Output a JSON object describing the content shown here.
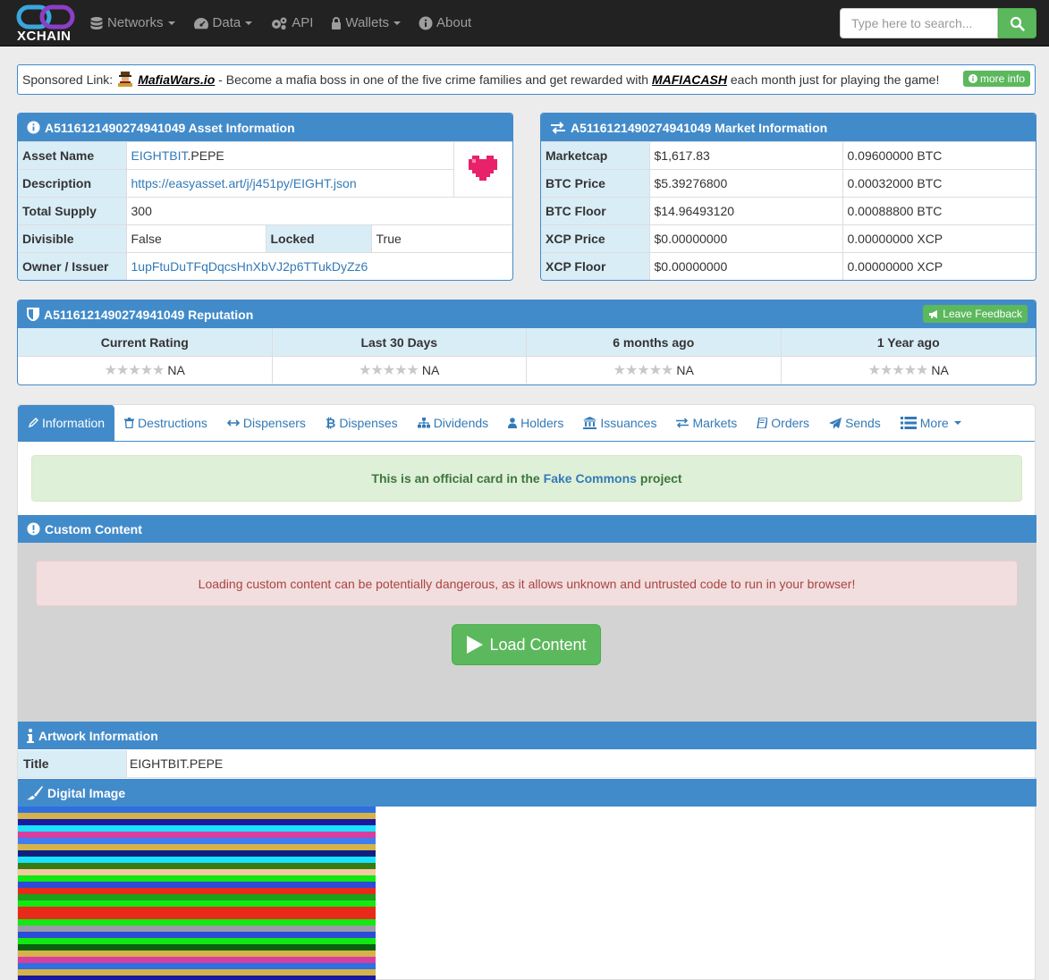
{
  "nav": {
    "brand": "XCHAIN",
    "items": [
      {
        "label": "Networks",
        "icon": "database-icon",
        "caret": true
      },
      {
        "label": "Data",
        "icon": "dashboard-icon",
        "caret": true
      },
      {
        "label": "API",
        "icon": "cogs-icon",
        "caret": false
      },
      {
        "label": "Wallets",
        "icon": "lock-icon",
        "caret": true
      },
      {
        "label": "About",
        "icon": "info-icon",
        "caret": false
      }
    ],
    "search_placeholder": "Type here to search..."
  },
  "sponsor": {
    "prefix": "Sponsored Link:",
    "link": "MafiaWars.io",
    "text1": " - Become a mafia boss in one of the five crime families and get rewarded with ",
    "token": "MAFIACASH",
    "text2": " each month just for playing the game!",
    "more": "more info"
  },
  "asset": {
    "heading": "A5116121490274941049 Asset Information",
    "name_label": "Asset Name",
    "name_prefix": "EIGHTBIT",
    "name_suffix": ".PEPE",
    "desc_label": "Description",
    "desc": "https://easyasset.art/j/j451py/EIGHT.json",
    "supply_label": "Total Supply",
    "supply": "300",
    "divisible_label": "Divisible",
    "divisible": "False",
    "locked_label": "Locked",
    "locked": "True",
    "owner_label": "Owner / Issuer",
    "owner": "1upFtuDuTFqDqcsHnXbVJ2p6TTukDyZz6"
  },
  "market": {
    "heading": "A5116121490274941049 Market Information",
    "rows": [
      {
        "label": "Marketcap",
        "usd": "$1,617.83",
        "crypto": "0.09600000 BTC"
      },
      {
        "label": "BTC Price",
        "usd": "$5.39276800",
        "crypto": "0.00032000 BTC"
      },
      {
        "label": "BTC Floor",
        "usd": "$14.96493120",
        "crypto": "0.00088800 BTC"
      },
      {
        "label": "XCP Price",
        "usd": "$0.00000000",
        "crypto": "0.00000000 XCP"
      },
      {
        "label": "XCP Floor",
        "usd": "$0.00000000",
        "crypto": "0.00000000 XCP"
      }
    ]
  },
  "reputation": {
    "heading": "A5116121490274941049 Reputation",
    "feedback": "Leave Feedback",
    "columns": [
      {
        "label": "Current Rating",
        "value": "NA"
      },
      {
        "label": "Last 30 Days",
        "value": "NA"
      },
      {
        "label": "6 months ago",
        "value": "NA"
      },
      {
        "label": "1 Year ago",
        "value": "NA"
      }
    ],
    "stars": "★★★★★"
  },
  "tabs": [
    {
      "label": "Information",
      "icon": "pencil-icon"
    },
    {
      "label": "Destructions",
      "icon": "trash-icon"
    },
    {
      "label": "Dispensers",
      "icon": "arrows-h-icon"
    },
    {
      "label": "Dispenses",
      "icon": "bitcoin-icon"
    },
    {
      "label": "Dividends",
      "icon": "sitemap-icon"
    },
    {
      "label": "Holders",
      "icon": "user-icon"
    },
    {
      "label": "Issuances",
      "icon": "bank-icon"
    },
    {
      "label": "Markets",
      "icon": "exchange-icon"
    },
    {
      "label": "Orders",
      "icon": "book-icon"
    },
    {
      "label": "Sends",
      "icon": "paper-plane-icon"
    },
    {
      "label": "More",
      "icon": "list-icon"
    }
  ],
  "official": {
    "pre": "This is an official card in the",
    "project": "Fake Commons",
    "post": "project"
  },
  "custom": {
    "heading": "Custom Content",
    "warning": "Loading custom content can be potentially dangerous, as it allows unknown and untrusted code to run in your browser!",
    "button": "Load Content"
  },
  "artwork": {
    "heading": "Artwork Information",
    "title_label": "Title",
    "title": "EIGHTBIT.PEPE"
  },
  "digital": {
    "heading": "Digital Image",
    "stripe_colors": [
      "#2f6fe0",
      "#d4b34a",
      "#1a1aa0",
      "#19e3ff",
      "#d83ea0",
      "#3f7df0",
      "#d4b34a",
      "#102080",
      "#19e3ff",
      "#3a7a12",
      "#f2c9a0",
      "#12e812",
      "#2c4cd8",
      "#e82a1a",
      "#1aa01a",
      "#12e812",
      "#e82a1a",
      "#e82a1a",
      "#12e812",
      "#9a9aa8",
      "#2c4cd8",
      "#12e812",
      "#0a6010",
      "#d4b34a",
      "#d83ea0",
      "#2f6fe0",
      "#d4b34a",
      "#1a1aa0"
    ]
  }
}
